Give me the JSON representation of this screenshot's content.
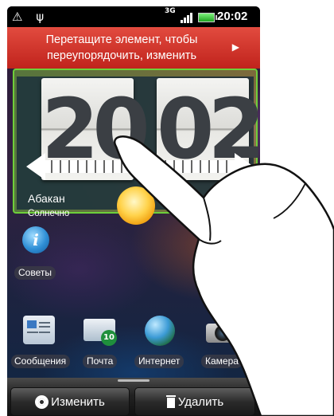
{
  "status_bar": {
    "left_icons": "⚠ ψ",
    "network_type": "3G",
    "time": "20:02"
  },
  "banner": {
    "text_line1": "Перетащите элемент, чтобы",
    "text_line2": "переупорядочить, изменить",
    "arrow": "▶"
  },
  "clock_widget": {
    "hours": "20",
    "minutes": "02",
    "city": "Абакан",
    "weather": "Солнечно"
  },
  "shortcuts": {
    "tips_label": "Советы"
  },
  "apps": [
    {
      "label": "Сообщения"
    },
    {
      "label": "Почта",
      "badge": "10"
    },
    {
      "label": "Интернет"
    },
    {
      "label": "Камера"
    }
  ],
  "toolbar": {
    "edit_label": "Изменить",
    "delete_label": "Удалить"
  }
}
